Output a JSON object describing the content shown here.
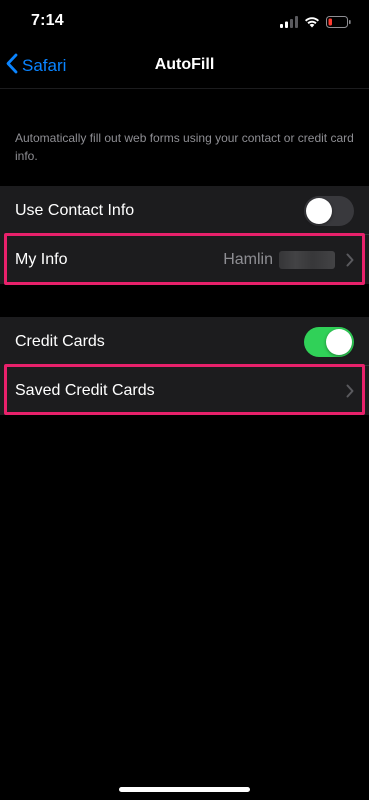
{
  "status_bar": {
    "time": "7:14",
    "icons": [
      "cellular-signal-icon",
      "wifi-icon",
      "battery-low-icon"
    ],
    "battery_color": "#ff3b30"
  },
  "nav": {
    "back_label": "Safari",
    "title": "AutoFill",
    "accent_color": "#0a84ff"
  },
  "description": "Automatically fill out web forms using your contact or credit card info.",
  "contact_group": {
    "use_contact_info": {
      "label": "Use Contact Info",
      "toggle_on": false
    },
    "my_info": {
      "label": "My Info",
      "value": "Hamlin",
      "value_suffix_redacted": true,
      "highlighted": true
    }
  },
  "credit_group": {
    "credit_cards": {
      "label": "Credit Cards",
      "toggle_on": true,
      "toggle_color": "#30d158"
    },
    "saved_credit_cards": {
      "label": "Saved Credit Cards",
      "highlighted": true
    }
  },
  "highlight_color": "#e8216b"
}
